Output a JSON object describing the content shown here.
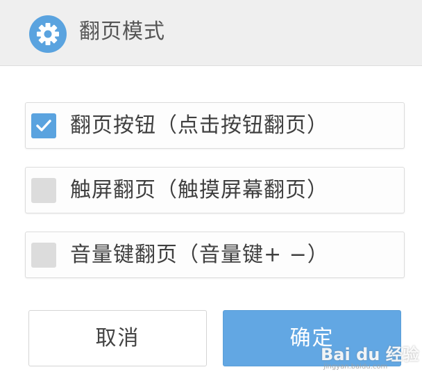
{
  "header": {
    "title": "翻页模式",
    "icon": "gear-icon",
    "icon_color": "#5aa3df"
  },
  "options": [
    {
      "label": "翻页按钮（点击按钮翻页）",
      "checked": true
    },
    {
      "label": "触屏翻页（触摸屏幕翻页）",
      "checked": false
    },
    {
      "label": "音量键翻页（音量键+ −）",
      "checked": false
    }
  ],
  "buttons": {
    "cancel_label": "取消",
    "ok_label": "确定"
  },
  "watermark": {
    "text": "Bai du 经验",
    "sub": "jingyan.baidu.com"
  },
  "colors": {
    "accent": "#62a7e3",
    "checkbox_checked": "#5aa3df",
    "checkbox_unchecked": "#dcdcdc",
    "header_bg": "#efefef"
  }
}
